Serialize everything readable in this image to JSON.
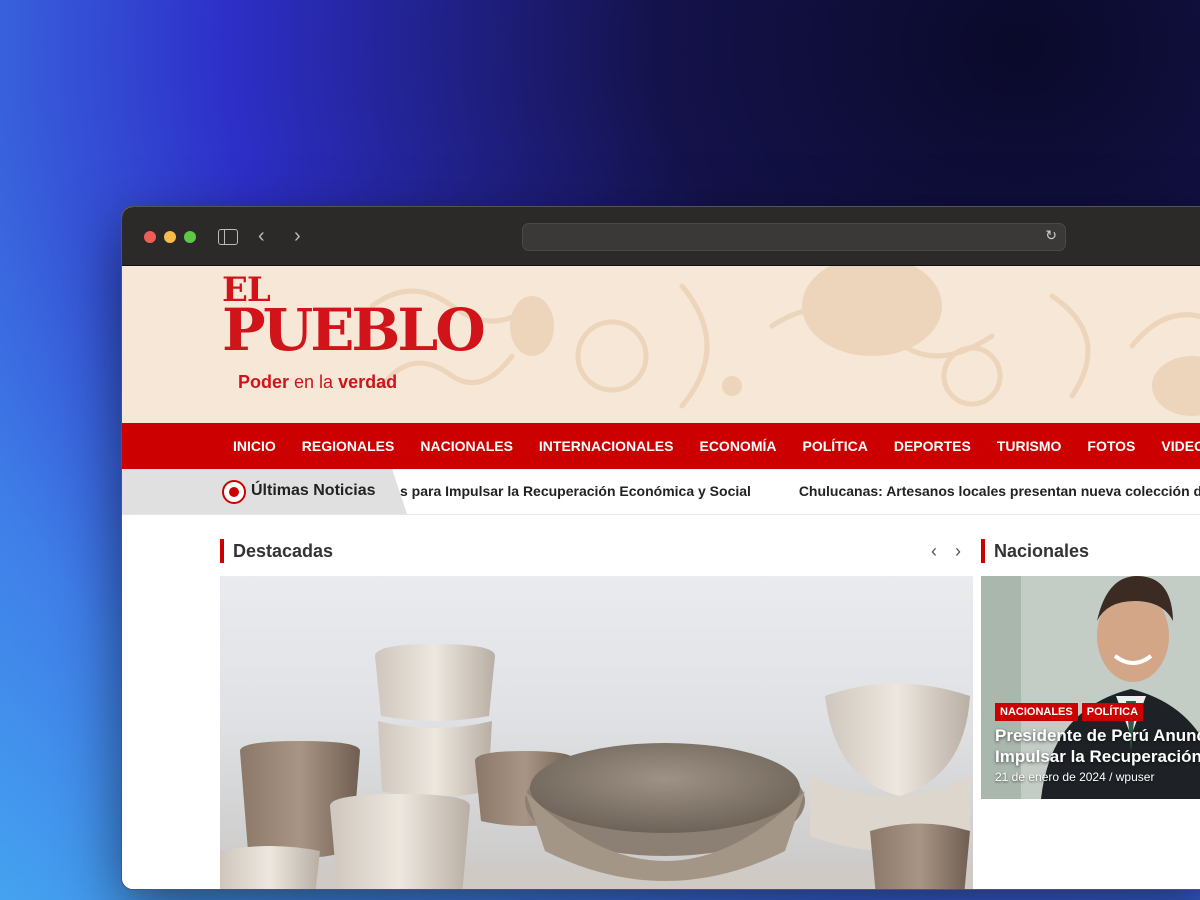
{
  "browser": {
    "url": "",
    "icons": {
      "sidebar": "sidebar-icon",
      "back": "chevron-left-icon",
      "forward": "chevron-right-icon",
      "reload": "reload-icon"
    }
  },
  "site": {
    "logo": {
      "line1": "EL",
      "line2": "PUEBLO",
      "tagline_a": "Poder",
      "tagline_b": " en la ",
      "tagline_c": "verdad"
    },
    "brand_color": "#cc0000",
    "nav": [
      "INICIO",
      "REGIONALES",
      "NACIONALES",
      "INTERNACIONALES",
      "ECONOMÍA",
      "POLÍTICA",
      "DEPORTES",
      "TURISMO",
      "FOTOS",
      "VIDEOS"
    ],
    "ticker": {
      "label": "Últimas Noticias",
      "items": [
        "s para Impulsar la Recuperación Económica y Social",
        "Chulucanas: Artesanos locales presentan nueva colección de cerámica"
      ]
    }
  },
  "featured": {
    "section_title": "Destacadas",
    "prev_icon": "chevron-left-icon",
    "next_icon": "chevron-right-icon"
  },
  "nacionales": {
    "section_title": "Nacionales",
    "card": {
      "tags": [
        "NACIONALES",
        "POLÍTICA"
      ],
      "title_line1": "Presidente de Perú Anuncia",
      "title_line2": "Impulsar la Recuperación E",
      "meta": "21 de enero de 2024 / wpuser"
    }
  }
}
